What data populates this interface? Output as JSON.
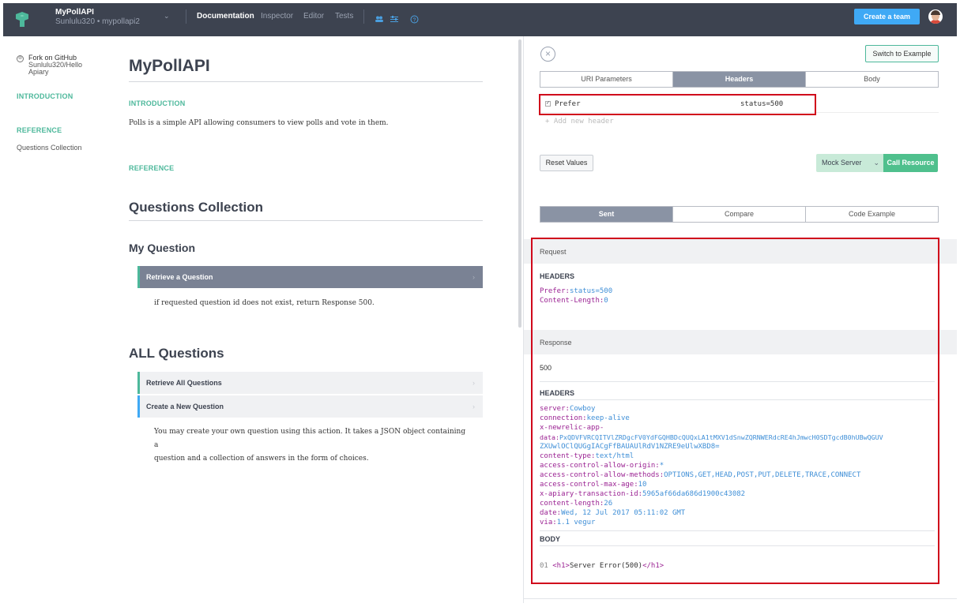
{
  "topbar": {
    "app_title": "MyPollAPI",
    "app_subtitle": "Sunlulu320 • mypollapi2",
    "caret": "⌄",
    "tabs": [
      "Documentation",
      "Inspector",
      "Editor",
      "Tests"
    ],
    "active_tab": "Documentation",
    "create_team": "Create a team",
    "accent": "#3fa9f5"
  },
  "sidebar": {
    "fork_title": "Fork on GitHub",
    "fork_repo": "Sunlulu320/Hello Apiary",
    "intro": "INTRODUCTION",
    "reference": "REFERENCE",
    "items": [
      "Questions Collection"
    ]
  },
  "doc": {
    "title": "MyPollAPI",
    "intro_label": "INTRODUCTION",
    "intro_text": "Polls is a simple API allowing consumers to view polls and vote in them.",
    "reference_label": "REFERENCE",
    "collection_title": "Questions Collection",
    "my_question": {
      "title": "My Question",
      "action": "Retrieve a Question",
      "description": "if requested question id does not exist, return Response 500."
    },
    "all_questions": {
      "title": "ALL Questions",
      "actions": [
        "Retrieve All Questions",
        "Create a New Question"
      ],
      "description_1": "You may create your own question using this action. It takes a JSON object containing a",
      "description_2": "question and a collection of answers in the form of choices."
    }
  },
  "console": {
    "close": "×",
    "switch_button": "Switch to Example",
    "param_tabs": [
      "URI Parameters",
      "Headers",
      "Body"
    ],
    "active_param_tab": "Headers",
    "header_row": {
      "checked": true,
      "name": "Prefer",
      "value": "status=500"
    },
    "add_header_placeholder": "+ Add new header",
    "reset_button": "Reset Values",
    "mock_server": "Mock Server",
    "call_resource": "Call Resource",
    "result_tabs": [
      "Sent",
      "Compare",
      "Code Example"
    ],
    "active_result_tab": "Sent",
    "request": {
      "label": "Request",
      "headers_title": "HEADERS",
      "headers": [
        {
          "key": "Prefer:",
          "value": "status=500"
        },
        {
          "key": "Content-Length:",
          "value": "0"
        }
      ]
    },
    "response": {
      "label": "Response",
      "status": "500",
      "headers_title": "HEADERS",
      "headers": [
        {
          "key": "server:",
          "value": "Cowboy"
        },
        {
          "key": "connection:",
          "value": "keep-alive"
        },
        {
          "key": "x-newrelic-app-",
          "value": ""
        },
        {
          "key": "data:",
          "value": "PxQDVFVRCQITVlZRDgcFV0YdFGQHBDcQUQxLA1tMXV1dSnwZQRNWERdcRE4hJmwcH0SDTgcdB0hUBwQGUV"
        },
        {
          "key": "",
          "value": "ZXUwlOClQUGgIACgFfBAUAUlRdV1NZRE9eUlwXBD8="
        },
        {
          "key": "content-type:",
          "value": "text/html"
        },
        {
          "key": "access-control-allow-origin:",
          "value": "*"
        },
        {
          "key": "access-control-allow-methods:",
          "value": "OPTIONS,GET,HEAD,POST,PUT,DELETE,TRACE,CONNECT"
        },
        {
          "key": "access-control-max-age:",
          "value": "10"
        },
        {
          "key": "x-apiary-transaction-id:",
          "value": "5965af66da686d1900c43082"
        },
        {
          "key": "content-length:",
          "value": "26"
        },
        {
          "key": "date:",
          "value": "Wed, 12 Jul 2017 05:11:02 GMT"
        },
        {
          "key": "via:",
          "value": "1.1 vegur"
        }
      ],
      "body_title": "BODY",
      "body_line_no": "01",
      "body_open": "<h1>",
      "body_text": "Server Error(500)",
      "body_close": "</h1>"
    }
  }
}
